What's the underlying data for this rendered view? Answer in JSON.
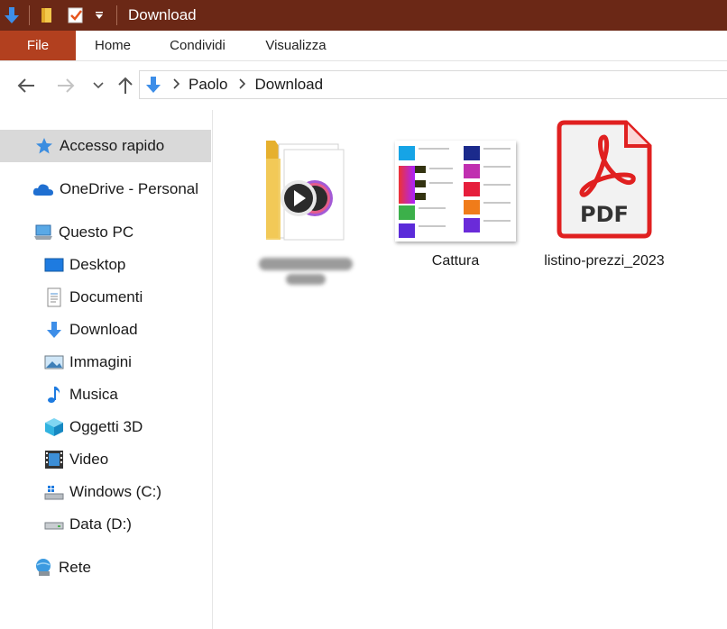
{
  "window": {
    "title": "Download"
  },
  "quick_access_icons": [
    "download-arrow-icon",
    "folder-icon",
    "properties-checkbox-icon",
    "customize-dropdown-icon"
  ],
  "ribbon": {
    "tabs": [
      "File",
      "Home",
      "Condividi",
      "Visualizza"
    ]
  },
  "navigation": {
    "back_icon": "arrow-left-icon",
    "forward_icon": "arrow-right-icon",
    "recent_icon": "chevron-down-icon",
    "up_icon": "arrow-up-icon"
  },
  "address_bar": {
    "crumbs": [
      "Paolo",
      "Download"
    ]
  },
  "sidebar": {
    "items": [
      {
        "label": "Accesso rapido",
        "icon": "star-icon",
        "selected": true
      },
      {
        "label": "OneDrive - Personal",
        "icon": "cloud-icon"
      },
      {
        "label": "Questo PC",
        "icon": "computer-icon"
      },
      {
        "label": "Desktop",
        "icon": "desktop-icon"
      },
      {
        "label": "Documenti",
        "icon": "document-icon"
      },
      {
        "label": "Download",
        "icon": "download-icon"
      },
      {
        "label": "Immagini",
        "icon": "pictures-icon"
      },
      {
        "label": "Musica",
        "icon": "music-icon"
      },
      {
        "label": "Oggetti 3D",
        "icon": "cube-icon"
      },
      {
        "label": "Video",
        "icon": "video-icon"
      },
      {
        "label": "Windows (C:)",
        "icon": "windows-drive-icon"
      },
      {
        "label": "Data (D:)",
        "icon": "drive-icon"
      },
      {
        "label": "Rete",
        "icon": "network-icon"
      }
    ]
  },
  "files": [
    {
      "name": "",
      "type": "folder",
      "name_redacted": true
    },
    {
      "name": "Cattura",
      "type": "image"
    },
    {
      "name": "listino-prezzi_2023",
      "type": "pdf",
      "badge": "PDF"
    }
  ],
  "colors": {
    "titlebar": "#6b2816",
    "file_tab": "#b2401f",
    "pdf_red": "#e02020",
    "selection": "#d9d9d9",
    "accent_blue": "#1e7be0"
  }
}
